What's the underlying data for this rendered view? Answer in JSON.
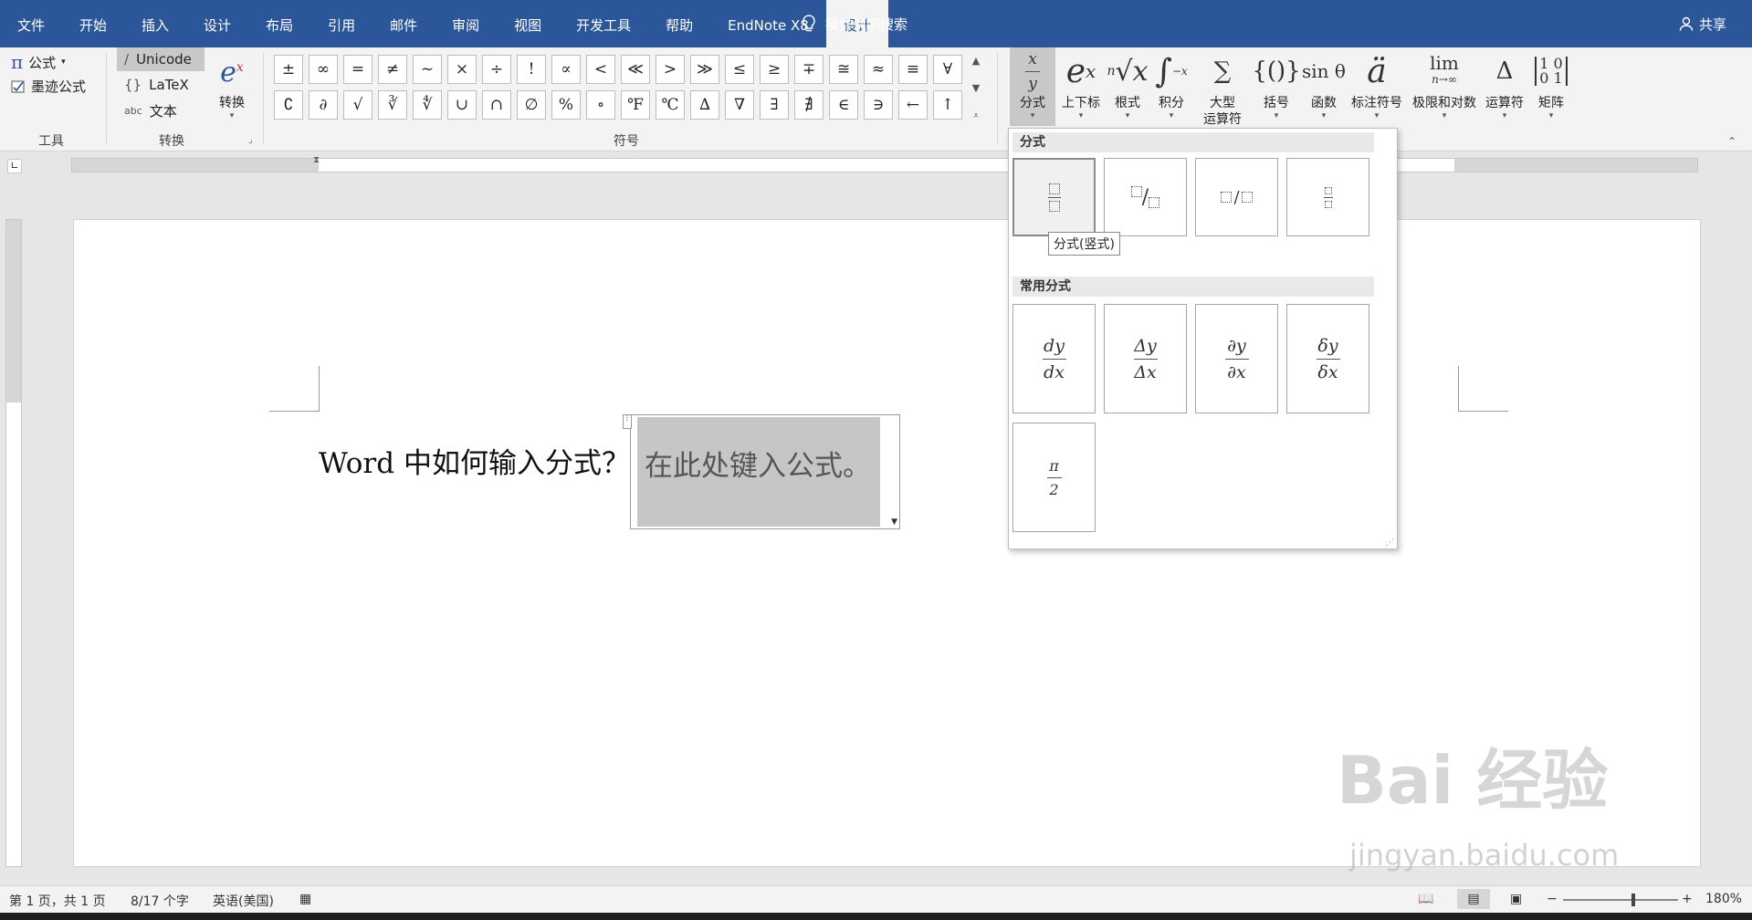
{
  "menubar": {
    "tabs": [
      {
        "label": "文件"
      },
      {
        "label": "开始"
      },
      {
        "label": "插入"
      },
      {
        "label": "设计"
      },
      {
        "label": "布局"
      },
      {
        "label": "引用"
      },
      {
        "label": "邮件"
      },
      {
        "label": "审阅"
      },
      {
        "label": "视图"
      },
      {
        "label": "开发工具"
      },
      {
        "label": "帮助"
      },
      {
        "label": "EndNote X8"
      },
      {
        "label": "设计"
      }
    ],
    "active_tab_index": 12,
    "search_label": "操作说明搜索",
    "share_label": "共享",
    "accent_color": "#2b579a"
  },
  "ribbon": {
    "tools": {
      "formula_label": "公式",
      "formula_icon": "π",
      "ink_label": "墨迹公式",
      "group_label": "工具"
    },
    "convert": {
      "unicode": "Unicode",
      "latex": "LaTeX",
      "text_prefix": "abc",
      "text": "文本",
      "convert_label": "转换",
      "group_label": "转换"
    },
    "symbols": {
      "items": [
        "±",
        "∞",
        "=",
        "≠",
        "~",
        "×",
        "÷",
        "!",
        "∝",
        "<",
        "≪",
        ">",
        "≫",
        "≤",
        "≥",
        "∓",
        "≅",
        "≈",
        "≡",
        "∀",
        "∁",
        "∂",
        "√",
        "∛",
        "∜",
        "∪",
        "∩",
        "∅",
        "%",
        "∘",
        "℉",
        "℃",
        "∆",
        "∇",
        "∃",
        "∄",
        "∈",
        "∋",
        "←",
        "↑"
      ],
      "group_label": "符号"
    },
    "structures": [
      {
        "label": "分式",
        "label2": "",
        "icon": "x/y"
      },
      {
        "label": "上下标",
        "label2": "",
        "icon": "eˣ"
      },
      {
        "label": "根式",
        "label2": "",
        "icon": "ⁿ√x"
      },
      {
        "label": "积分",
        "label2": "",
        "icon": "∫"
      },
      {
        "label": "大型",
        "label2": "运算符",
        "icon": "∑"
      },
      {
        "label": "括号",
        "label2": "",
        "icon": "{()}"
      },
      {
        "label": "函数",
        "label2": "",
        "icon": "sin θ"
      },
      {
        "label": "标注符号",
        "label2": "",
        "icon": "ä"
      },
      {
        "label": "极限和对数",
        "label2": "",
        "icon": "lim"
      },
      {
        "label": "运算符",
        "label2": "",
        "icon": "Δ"
      },
      {
        "label": "矩阵",
        "label2": "",
        "icon": "[10 01]"
      }
    ]
  },
  "document": {
    "text": "Word 中如何输入分式？",
    "equation_placeholder": "在此处键入公式。"
  },
  "gallery": {
    "section1": "分式",
    "section2": "常用分式",
    "tooltip": "分式(竖式)",
    "common": [
      {
        "num": "dy",
        "den": "dx"
      },
      {
        "num": "Δy",
        "den": "Δx"
      },
      {
        "num": "∂y",
        "den": "∂x"
      },
      {
        "num": "δy",
        "den": "δx"
      },
      {
        "num": "π",
        "den": "2"
      }
    ]
  },
  "statusbar": {
    "page": "第 1 页，共 1 页",
    "words": "8/17 个字",
    "language": "英语(美国)",
    "zoom": "180%"
  },
  "watermark": {
    "text": "Bai 经验",
    "sub": "jingyan.baidu.com"
  }
}
